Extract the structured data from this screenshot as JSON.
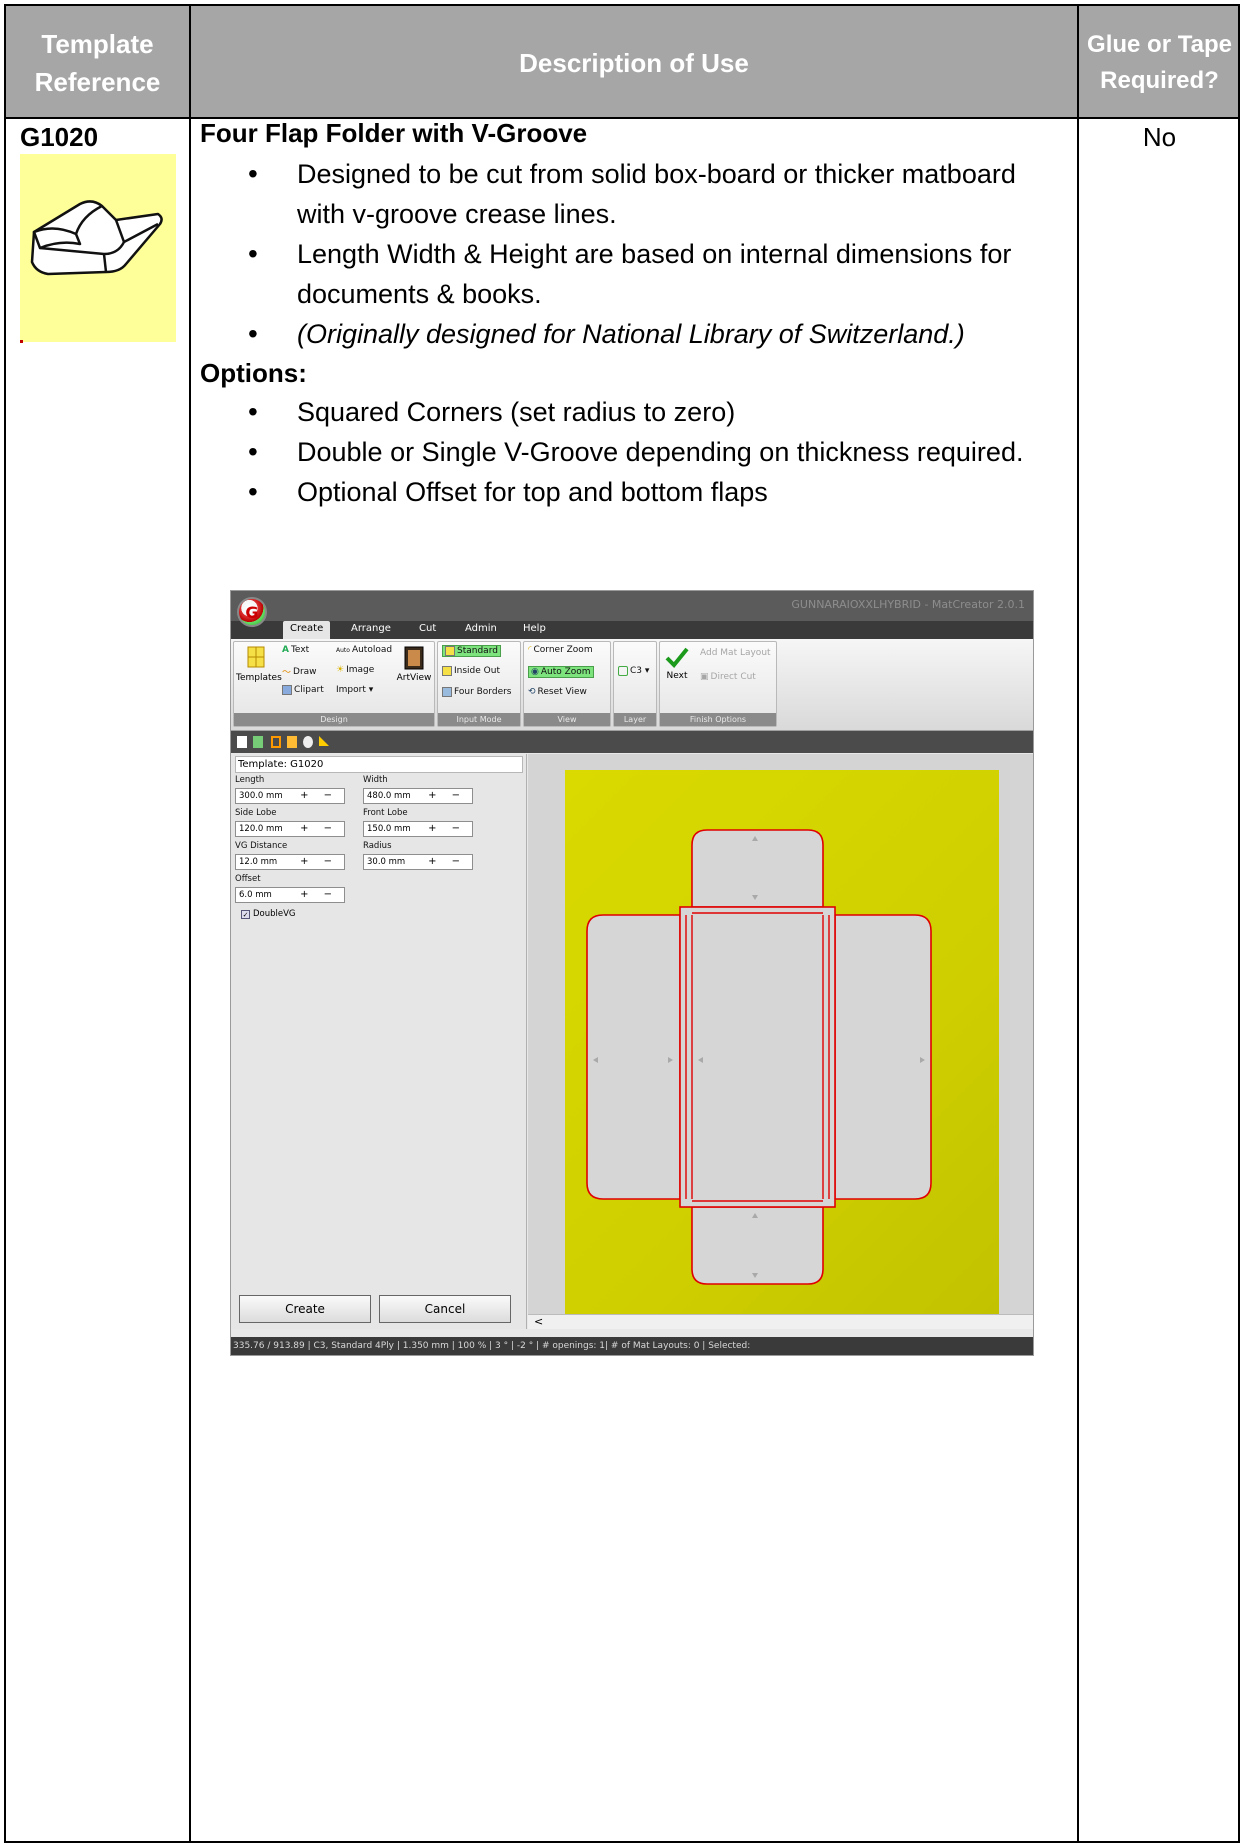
{
  "table": {
    "headers": {
      "reference": "Template Reference",
      "description": "Description of Use",
      "glue": "Glue or Tape Required?"
    },
    "row": {
      "code": "G1020",
      "title": "Four Flap Folder with V-Groove",
      "bullets": [
        "Designed to be cut from solid box-board or thicker matboard with v-groove crease lines.",
        "Length Width & Height are based on internal dimensions for documents & books.",
        "(Originally designed for National Library of Switzerland.)"
      ],
      "options_label": "Options:",
      "options": [
        "Squared Corners (set radius to zero)",
        "Double or Single V-Groove depending on thickness required.",
        "Optional Offset for top and bottom flaps"
      ],
      "glue": "No"
    }
  },
  "app": {
    "window_title": "GUNNARAIOXXLHYBRID - MatCreator 2.0.1",
    "menu": [
      "Create",
      "Arrange",
      "Cut",
      "Admin",
      "Help"
    ],
    "ribbon": {
      "design": {
        "caption": "Design",
        "templates": "Templates",
        "text": "Text",
        "autoload": "Autoload",
        "draw": "Draw",
        "image": "Image",
        "clipart": "Clipart",
        "import": "Import ▾",
        "artview": "ArtView"
      },
      "input_mode": {
        "caption": "Input Mode",
        "standard": "Standard",
        "inside_out": "Inside Out",
        "four_borders": "Four Borders"
      },
      "view": {
        "caption": "View",
        "corner_zoom": "Corner Zoom",
        "auto_zoom": "Auto Zoom",
        "reset_view": "Reset View"
      },
      "layer": {
        "caption": "Layer",
        "c3": "C3 ▾"
      },
      "finish": {
        "caption": "Finish Options",
        "next": "Next",
        "add_mat_layout": "Add Mat Layout",
        "direct_cut": "Direct Cut"
      }
    },
    "panel": {
      "template": "Template: G1020",
      "length_label": "Length",
      "length_value": "300.0 mm",
      "width_label": "Width",
      "width_value": "480.0 mm",
      "side_lobe_label": "Side Lobe",
      "side_lobe_value": "120.0 mm",
      "front_lobe_label": "Front Lobe",
      "front_lobe_value": "150.0 mm",
      "vg_distance_label": "VG Distance",
      "vg_distance_value": "12.0 mm",
      "radius_label": "Radius",
      "radius_value": "30.0 mm",
      "offset_label": "Offset",
      "offset_value": "6.0 mm",
      "double_vg": "DoubleVG",
      "stepper": "+ −",
      "create": "Create",
      "cancel": "Cancel"
    },
    "scroll_left": "<",
    "status": "335.76 / 913.89  |  C3, Standard 4Ply  |  1.350 mm  |  100 %  |  3 °  |  -2 °  |  # openings:  1| # of Mat Layouts: 0  |  Selected:"
  },
  "colors": {
    "header_bg": "#a6a6a6",
    "thumb_bg": "#ffff99",
    "matboard": "#cfcf00",
    "cutline": "#e00000"
  }
}
